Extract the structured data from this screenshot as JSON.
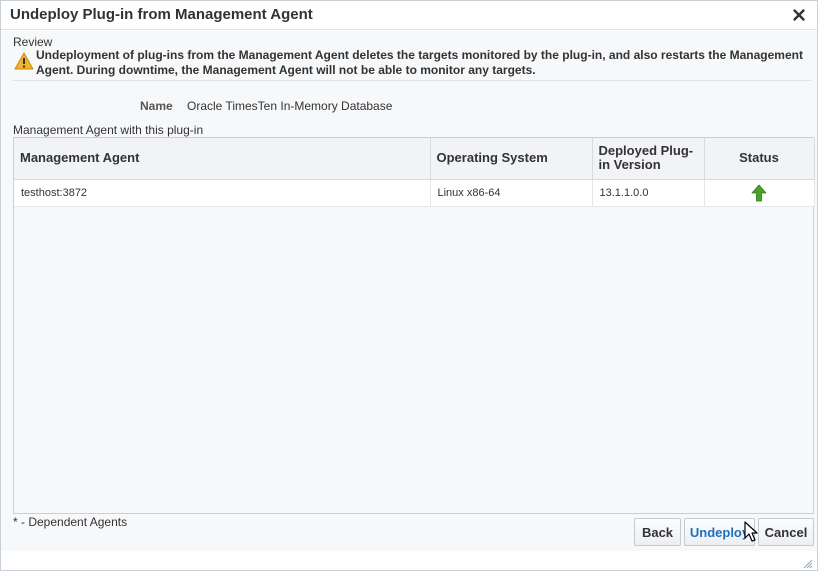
{
  "dialog": {
    "title": "Undeploy Plug-in from Management Agent"
  },
  "review": {
    "heading": "Review",
    "warning_text": "Undeployment of plug-ins from the Management Agent deletes the targets monitored by the plug-in, and also restarts the Management Agent. During downtime, the Management Agent will not be able to monitor any targets."
  },
  "plugin": {
    "name_label": "Name",
    "name_value": "Oracle TimesTen In-Memory Database"
  },
  "agents_section": {
    "label": "Management Agent with this plug-in",
    "columns": [
      "Management Agent",
      "Operating System",
      "Deployed Plug-in Version",
      "Status"
    ],
    "rows": [
      {
        "agent": "testhost:3872",
        "os": "Linux x86-64",
        "version": "13.1.1.0.0",
        "status_icon": "status-up-icon"
      }
    ]
  },
  "footnote": "* - Dependent Agents",
  "buttons": {
    "back": "Back",
    "undeploy": "Undeploy",
    "cancel": "Cancel"
  },
  "colors": {
    "status_up": "#4aa02c",
    "warning": "#f0b429",
    "undeploy_text": "#1f6fbf"
  }
}
